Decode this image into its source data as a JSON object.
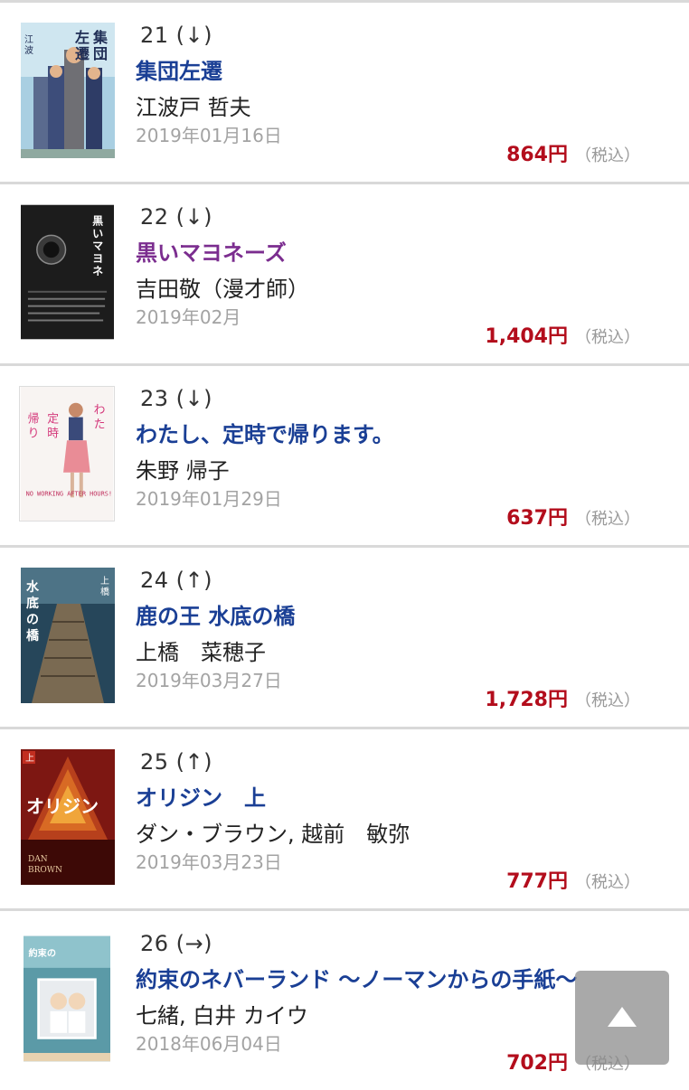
{
  "books": [
    {
      "rank": "21 (↓)",
      "title": "集団左遷",
      "author": "江波戸 哲夫",
      "date": "2019年01月16日",
      "price": "864円",
      "tax": "（税込）"
    },
    {
      "rank": "22 (↓)",
      "title": "黒いマヨネーズ",
      "author": "吉田敬（漫才師）",
      "date": "2019年02月",
      "price": "1,404円",
      "tax": "（税込）"
    },
    {
      "rank": "23 (↓)",
      "title": "わたし、定時で帰ります。",
      "author": "朱野 帰子",
      "date": "2019年01月29日",
      "price": "637円",
      "tax": "（税込）"
    },
    {
      "rank": "24 (↑)",
      "title": "鹿の王 水底の橋",
      "author": "上橋　菜穂子",
      "date": "2019年03月27日",
      "price": "1,728円",
      "tax": "（税込）"
    },
    {
      "rank": "25 (↑)",
      "title": "オリジン　上",
      "author": "ダン・ブラウン, 越前　敏弥",
      "date": "2019年03月23日",
      "price": "777円",
      "tax": "（税込）"
    },
    {
      "rank": "26 (→)",
      "title": "約束のネバーランド ～ノーマンからの手紙～",
      "author": "七緒, 白井 カイウ",
      "date": "2018年06月04日",
      "price": "702円",
      "tax": "（税込）"
    }
  ],
  "covers": [
    {
      "text": "集団左遷",
      "sub": "江波戸哲夫",
      "bg": "#9fc7dc"
    },
    {
      "text": "黒いマヨネーズ",
      "sub": "吉田敬",
      "bg": "#1b1b1b"
    },
    {
      "text": "わたし、定時で帰ります。",
      "sub": "NO WORKING AFTER HOURS!",
      "bg": "#f7f3f1"
    },
    {
      "text": "鹿の王 水底の橋",
      "sub": "上橋菜穂子",
      "bg": "#1f3b4d"
    },
    {
      "text": "オリジン",
      "sub": "DAN BROWN",
      "bg": "#7a1410"
    },
    {
      "text": "約束のネバーランド",
      "sub": "",
      "bg": "#5d9aa8"
    }
  ],
  "scroll_top": {
    "icon": "arrow-up-icon"
  }
}
